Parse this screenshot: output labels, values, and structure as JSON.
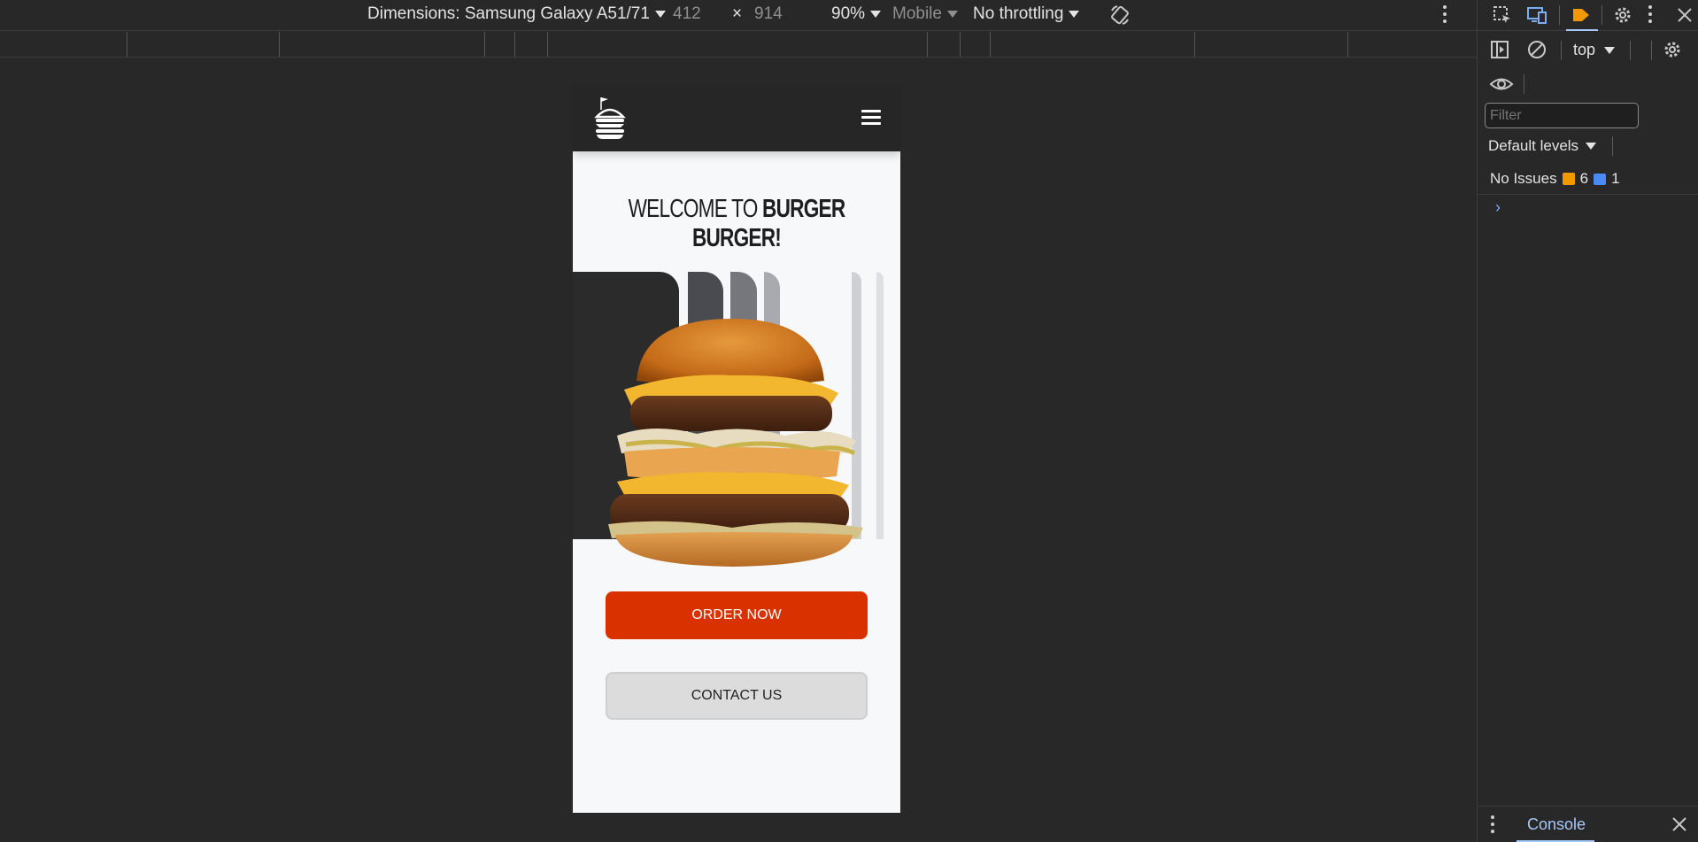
{
  "device_toolbar": {
    "dimensions_label": "Dimensions: Samsung Galaxy A51/71",
    "width": "412",
    "times": "×",
    "height": "914",
    "zoom": "90%",
    "device_type": "Mobile",
    "throttling": "No throttling"
  },
  "page": {
    "welcome_prefix": "WELCOME TO ",
    "welcome_brand": "BURGER BURGER!",
    "order_button": "ORDER NOW",
    "contact_button": "CONTACT US",
    "colors": {
      "header_bg": "#262626",
      "accent": "#d93200",
      "page_bg": "#f7f8fa",
      "bar_dark": "#2b2b2b",
      "bar_mid": "#4a4b50",
      "bar_grey": "#76777c",
      "bar_light": "#a9aab0",
      "bar_pale": "#cfd0d4"
    },
    "icons": [
      "burger-logo-icon",
      "hamburger-menu-icon",
      "burger-photo"
    ]
  },
  "devtools": {
    "context": "top",
    "filter_placeholder": "Filter",
    "levels": "Default levels",
    "issues_label": "No Issues",
    "warn_count": "6",
    "info_count": "1",
    "prompt": "›",
    "drawer_tab": "Console"
  }
}
